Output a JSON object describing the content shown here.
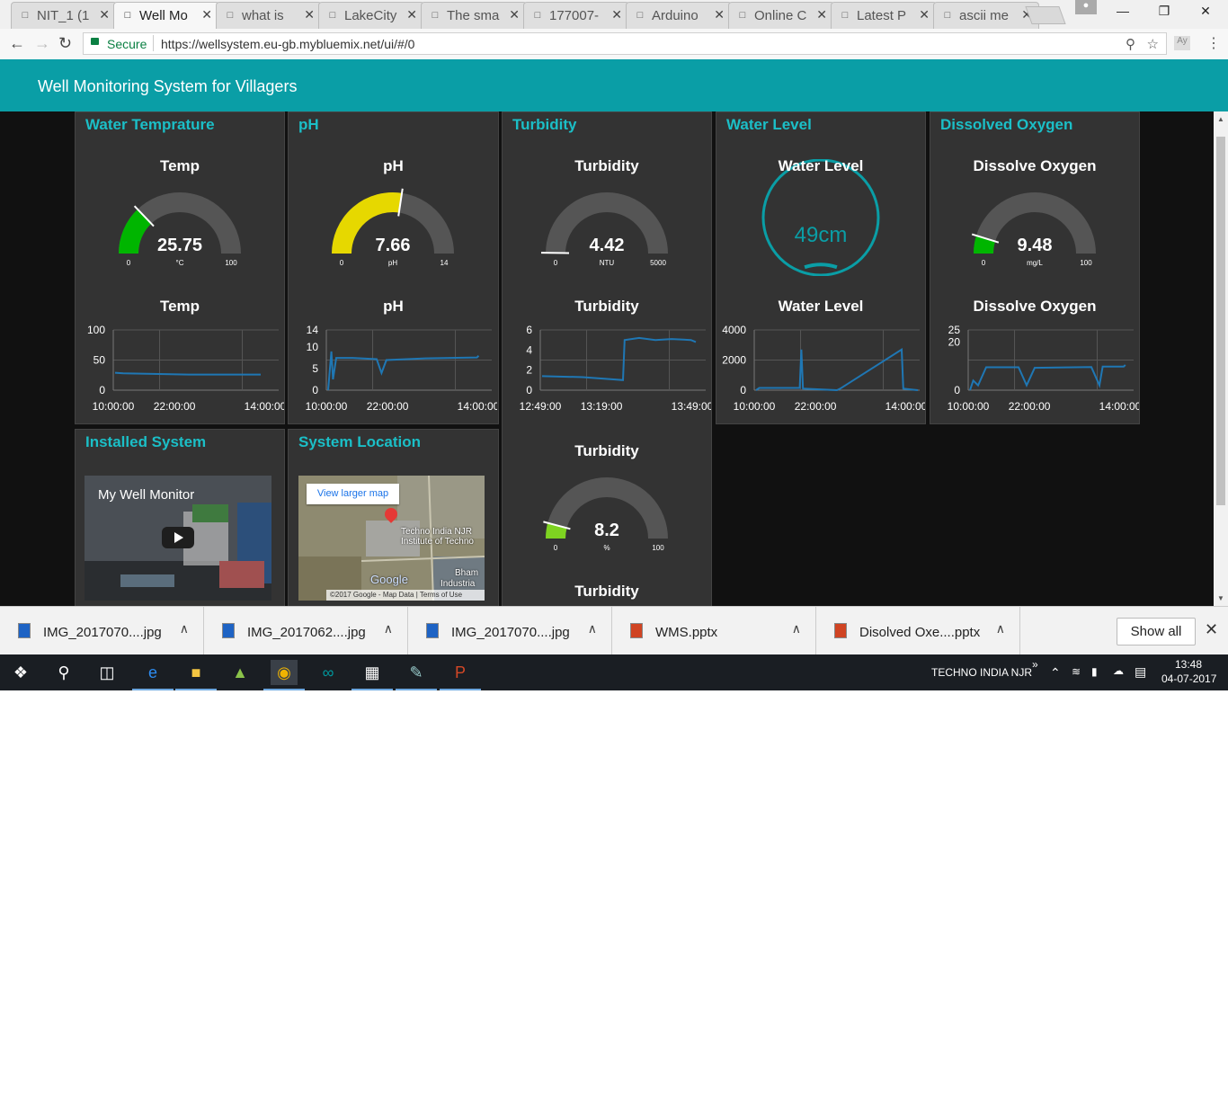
{
  "browser": {
    "tabs": [
      {
        "label": "NIT_1 (1",
        "icon": "page-icon"
      },
      {
        "label": "Well Mo",
        "icon": "node-red-icon"
      },
      {
        "label": "what is",
        "icon": "google-icon"
      },
      {
        "label": "LakeCity",
        "icon": "page-icon"
      },
      {
        "label": "The sma",
        "icon": "news-icon"
      },
      {
        "label": "177007-",
        "icon": "slides-icon"
      },
      {
        "label": "Arduino",
        "icon": "arduino-icon"
      },
      {
        "label": "Online C",
        "icon": "chart-icon"
      },
      {
        "label": "Latest P",
        "icon": "gmail-icon"
      },
      {
        "label": "ascii me",
        "icon": "google-icon"
      }
    ],
    "active_tab": 1,
    "secure_label": "Secure",
    "url": "https://wellsystem.eu-gb.mybluemix.net/ui/#/0"
  },
  "app": {
    "title": "Well Monitoring System for Villagers"
  },
  "cards": {
    "temp": {
      "title": "Water Temprature",
      "gauge_label": "Temp",
      "chart_label": "Temp"
    },
    "ph": {
      "title": "pH",
      "gauge_label": "pH",
      "chart_label": "pH"
    },
    "turbidity": {
      "title": "Turbidity",
      "gauge_label": "Turbidity",
      "chart_label": "Turbidity",
      "gauge2_label": "Turbidity",
      "bottom_label": "Turbidity"
    },
    "level": {
      "title": "Water Level",
      "gauge_label": "Water Level",
      "chart_label": "Water Level"
    },
    "oxygen": {
      "title": "Dissolved Oxygen",
      "gauge_label": "Dissolve Oxygen",
      "chart_label": "Dissolve Oxygen"
    },
    "installed": {
      "title": "Installed System",
      "video_title": "My Well Monitor"
    },
    "location": {
      "title": "System Location",
      "map_button": "View larger map",
      "place_1": "Techno India NJR",
      "place_2": "Institute of Techno",
      "place_3": "Bham",
      "place_4": "Industria",
      "google": "Google",
      "copyright": "©2017 Google - Map Data",
      "terms": "Terms of Use"
    }
  },
  "gauges": [
    {
      "id": "temp",
      "value": 25.75,
      "display": "25.75",
      "unit": "°C",
      "min": 0,
      "max": 100,
      "min_label": "0",
      "max_label": "100",
      "color": "#00b500"
    },
    {
      "id": "ph",
      "value": 7.66,
      "display": "7.66",
      "unit": "pH",
      "min": 0,
      "max": 14,
      "min_label": "0",
      "max_label": "14",
      "color": "#e6d800"
    },
    {
      "id": "turb",
      "value": 4.42,
      "display": "4.42",
      "unit": "NTU",
      "min": 0,
      "max": 5000,
      "min_label": "0",
      "max_label": "5000",
      "color": "#00b500"
    },
    {
      "id": "oxy",
      "value": 9.48,
      "display": "9.48",
      "unit": "mg/L",
      "min": 0,
      "max": 100,
      "min_label": "0",
      "max_label": "100",
      "color": "#00b500"
    },
    {
      "id": "turb2",
      "value": 8.2,
      "display": "8.2",
      "unit": "%",
      "min": 0,
      "max": 100,
      "min_label": "0",
      "max_label": "100",
      "color": "#7ed321"
    }
  ],
  "donut": {
    "value": 49,
    "display": "49cm",
    "fill_fraction": 0.1,
    "color": "#0a9ea6"
  },
  "chart_data": [
    {
      "type": "line",
      "id": "temp",
      "series": [
        {
          "values": [
            [
              0,
              29
            ],
            [
              0.05,
              28
            ],
            [
              0.45,
              26
            ],
            [
              0.9,
              26
            ]
          ]
        }
      ],
      "yticks": [
        "100",
        "50",
        "0"
      ],
      "ylim": [
        0,
        100
      ],
      "xticks": [
        "10:00:00",
        "22:00:00",
        "14:00:00"
      ],
      "color": "#1f77b4"
    },
    {
      "type": "line",
      "id": "ph",
      "series": [
        {
          "values": [
            [
              0,
              0
            ],
            [
              0.02,
              9
            ],
            [
              0.03,
              2.5
            ],
            [
              0.05,
              7.5
            ],
            [
              0.15,
              7.5
            ],
            [
              0.3,
              7.2
            ],
            [
              0.33,
              4
            ],
            [
              0.36,
              7
            ],
            [
              0.6,
              7.4
            ],
            [
              0.92,
              7.6
            ],
            [
              0.93,
              8
            ]
          ]
        }
      ],
      "yticks": [
        "14",
        "10",
        "5",
        "0"
      ],
      "ylim": [
        0,
        14
      ],
      "xticks": [
        "10:00:00",
        "22:00:00",
        "14:00:00"
      ],
      "color": "#1f77b4"
    },
    {
      "type": "line",
      "id": "turb",
      "series": [
        {
          "values": [
            [
              0,
              1.4
            ],
            [
              0.25,
              1.3
            ],
            [
              0.5,
              1
            ],
            [
              0.51,
              5
            ],
            [
              0.6,
              5.2
            ],
            [
              0.7,
              5
            ],
            [
              0.8,
              5.1
            ],
            [
              0.92,
              5
            ],
            [
              0.95,
              4.8
            ]
          ]
        }
      ],
      "yticks": [
        "6",
        "4",
        "2",
        "0"
      ],
      "ylim": [
        0,
        6
      ],
      "xticks": [
        "12:49:00",
        "13:19:00",
        "13:49:00"
      ],
      "color": "#1f77b4"
    },
    {
      "type": "line",
      "id": "level",
      "series": [
        {
          "values": [
            [
              0,
              0
            ],
            [
              0.02,
              150
            ],
            [
              0.27,
              150
            ],
            [
              0.28,
              2700
            ],
            [
              0.29,
              100
            ],
            [
              0.5,
              0
            ],
            [
              0.52,
              100
            ],
            [
              0.9,
              2700
            ],
            [
              0.91,
              100
            ],
            [
              1,
              0
            ]
          ]
        }
      ],
      "yticks": [
        "4000",
        "2000",
        "0"
      ],
      "ylim": [
        0,
        4000
      ],
      "xticks": [
        "10:00:00",
        "22:00:00",
        "14:00:00"
      ],
      "color": "#1f77b4"
    },
    {
      "type": "line",
      "id": "oxy",
      "series": [
        {
          "values": [
            [
              0,
              0
            ],
            [
              0.02,
              4
            ],
            [
              0.05,
              2
            ],
            [
              0.1,
              9.5
            ],
            [
              0.3,
              9.5
            ],
            [
              0.35,
              2
            ],
            [
              0.4,
              9.3
            ],
            [
              0.75,
              9.6
            ],
            [
              0.8,
              2
            ],
            [
              0.82,
              9.8
            ],
            [
              0.95,
              9.8
            ],
            [
              0.96,
              10.5
            ]
          ]
        }
      ],
      "yticks": [
        "25",
        "20",
        "0"
      ],
      "ylim": [
        0,
        25
      ],
      "xticks": [
        "10:00:00",
        "22:00:00",
        "14:00:00"
      ],
      "color": "#1f77b4"
    }
  ],
  "downloads": {
    "items": [
      {
        "name": "IMG_2017070....jpg",
        "type": "image"
      },
      {
        "name": "IMG_2017062....jpg",
        "type": "image"
      },
      {
        "name": "IMG_2017070....jpg",
        "type": "image"
      },
      {
        "name": "WMS.pptx",
        "type": "ppt"
      },
      {
        "name": "Disolved Oxe....pptx",
        "type": "ppt"
      }
    ],
    "show_all": "Show all"
  },
  "taskbar": {
    "network": "TECHNO INDIA NJR",
    "time": "13:48",
    "date": "04-07-2017"
  }
}
